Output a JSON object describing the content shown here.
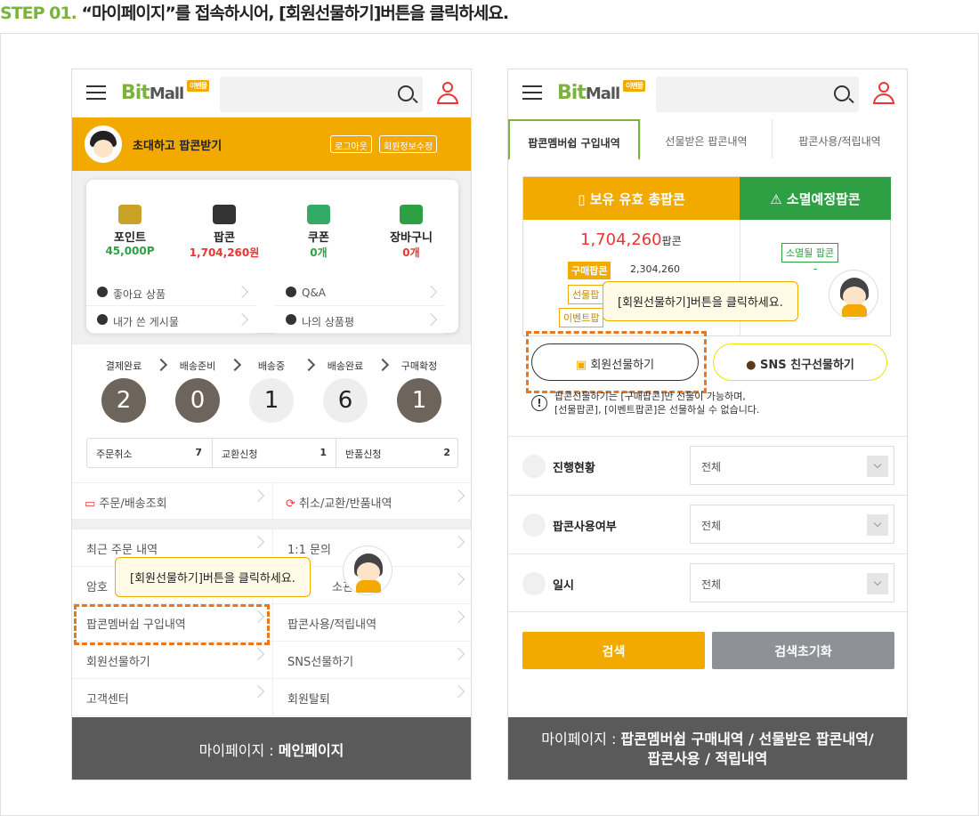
{
  "header": {
    "step_num": "STEP 01.",
    "step_text": "“마이페이지”를 접속하시어, [회원선물하기]버튼을 클릭하세요."
  },
  "common": {
    "logo_bit": "Bit",
    "logo_mall": "Mall",
    "logo_badge": "이벤몰"
  },
  "phone1": {
    "invite": "초대하고 팝콘받기",
    "logout": "로그아웃",
    "edit_info": "회원정보수정",
    "stats": [
      {
        "label": "포인트",
        "value": "45,000P",
        "color": "#2ea043"
      },
      {
        "label": "팝콘",
        "value": "1,704,260원",
        "color": "#e33"
      },
      {
        "label": "쿠폰",
        "value": "0개",
        "color": "#2ea043"
      },
      {
        "label": "장바구니",
        "value": "0개",
        "color": "#e33"
      }
    ],
    "links": [
      "좋아요 상품",
      "Q&A",
      "내가 쓴 게시물",
      "나의 상품평"
    ],
    "steps": [
      {
        "label": "결제완료",
        "count": "2"
      },
      {
        "label": "배송준비",
        "count": "0"
      },
      {
        "label": "배송중",
        "count": "1"
      },
      {
        "label": "배송완료",
        "count": "6"
      },
      {
        "label": "구매확정",
        "count": "1"
      }
    ],
    "counts": [
      {
        "label": "주문취소",
        "count": "7"
      },
      {
        "label": "교환신청",
        "count": "1"
      },
      {
        "label": "반품신청",
        "count": "2"
      }
    ],
    "order_links": [
      "주문/배송조회",
      "취소/교환/반품내역"
    ],
    "menu": [
      "최근 주문 내역",
      "1:1 문의",
      "암호",
      "소관",
      "팝콘멤버쉽 구입내역",
      "팝콘사용/적립내역",
      "회원선물하기",
      "SNS선물하기",
      "고객센터",
      "회원탈퇴"
    ],
    "callout": "[회원선물하기]버튼을 클릭하세요.",
    "footer_prefix": "마이페이지 : ",
    "footer_bold": "메인페이지"
  },
  "phone2": {
    "tabs": [
      "팝콘멤버쉽 구입내역",
      "선물받은 팝콘내역",
      "팝콘사용/적립내역"
    ],
    "head_own": "보유 유효 총팝콘",
    "head_expire": "소멸예정팝콘",
    "total_value": "1,704,260",
    "total_unit": "팝콘",
    "buy_tag": "구매팝콘",
    "buy_value": "2,304,260",
    "gift_tag": "선물팝",
    "event_tag": "이벤트팝",
    "expire_tag": "소멸될 팝콘",
    "expire_value": "-",
    "callout": "[회원선물하기]버튼을 클릭하세요.",
    "gift_btn": "회원선물하기",
    "sns_btn": "SNS 친구선물하기",
    "note_line1": "팝콘선물하기는 [구매팝콘]만 선물이 가능하며,",
    "note_line2": "[선물팝콘], [이벤트팝콘]은 선물하실 수 없습니다.",
    "filters": [
      {
        "label": "진행현황",
        "value": "전체"
      },
      {
        "label": "팝콘사용여부",
        "value": "전체"
      },
      {
        "label": "일시",
        "value": "전체"
      }
    ],
    "search_btn": "검색",
    "reset_btn": "검색초기화",
    "footer_prefix": "마이페이지 : ",
    "footer_bold1": "팝콘멤버쉽 구매내역 / 선물받은 팝콘내역/",
    "footer_bold2": "팝콘사용 / 적립내역"
  }
}
